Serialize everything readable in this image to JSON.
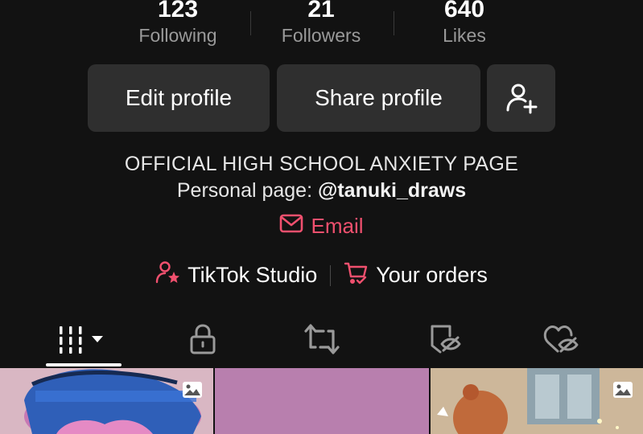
{
  "stats": [
    {
      "value": "123",
      "label": "Following"
    },
    {
      "value": "21",
      "label": "Followers"
    },
    {
      "value": "640",
      "label": "Likes"
    }
  ],
  "buttons": {
    "edit_profile": "Edit profile",
    "share_profile": "Share profile",
    "add_friend_icon": "person-plus-icon"
  },
  "bio": {
    "line1": "OFFICIAL HIGH SCHOOL ANXIETY PAGE",
    "line2_prefix": "Personal page: ",
    "line2_handle": "@tanuki_draws"
  },
  "email": {
    "label": "Email",
    "icon": "mail-icon"
  },
  "links": {
    "studio": "TikTok Studio",
    "orders": "Your orders"
  },
  "tabs": [
    {
      "icon": "grid-icon",
      "active": true
    },
    {
      "icon": "lock-icon"
    },
    {
      "icon": "repost-icon"
    },
    {
      "icon": "bookmark-hidden-icon"
    },
    {
      "icon": "heart-hidden-icon"
    }
  ],
  "colors": {
    "background": "#121212",
    "button": "#2f2f2f",
    "accent": "#f0506e",
    "muted": "#9a9a9a"
  }
}
